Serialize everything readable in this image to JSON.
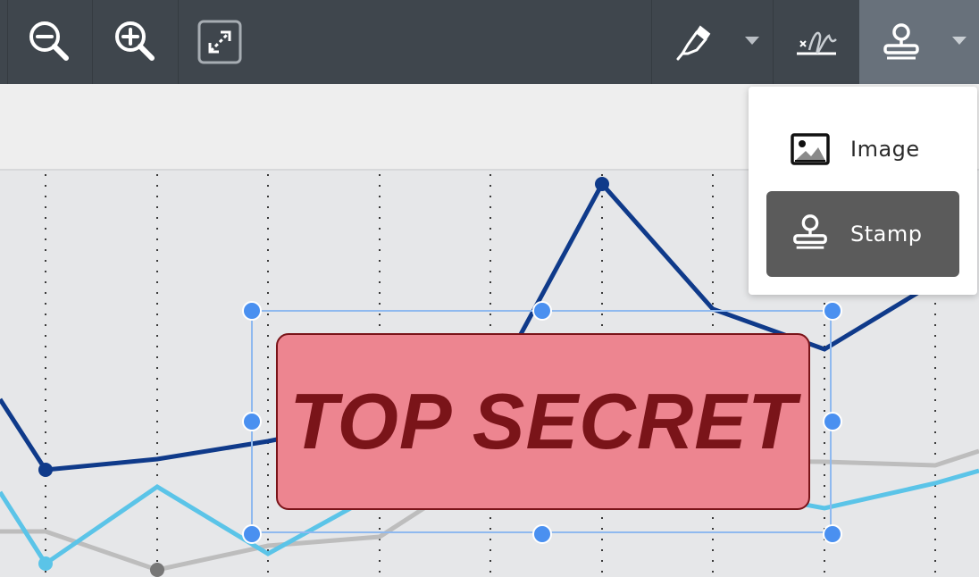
{
  "toolbar": {
    "buttons": [
      {
        "name": "zoom-out-button",
        "icon": "zoom-out-icon"
      },
      {
        "name": "zoom-in-button",
        "icon": "zoom-in-icon"
      },
      {
        "name": "fit-page-button",
        "icon": "expand-arrows-icon"
      },
      {
        "name": "annotate-pen-button",
        "icon": "highlighter-pen-icon"
      },
      {
        "name": "signature-button",
        "icon": "signature-icon"
      },
      {
        "name": "stamp-tool-button",
        "icon": "stamp-icon",
        "active": true
      }
    ]
  },
  "dropdown": {
    "items": [
      {
        "label": "Image",
        "icon": "image-icon",
        "selected": false
      },
      {
        "label": "Stamp",
        "icon": "stamp-icon",
        "selected": true
      }
    ]
  },
  "stamp": {
    "text": "TOP SECRET",
    "fill_color": "#ed8590",
    "text_color": "#7a1419"
  },
  "colors": {
    "toolbar_bg": "#3f464d",
    "toolbar_active_bg": "#68717b",
    "selection_handle": "#4a90f0",
    "series_dark_blue": "#0f3a8a",
    "series_light_blue": "#5bc4e8",
    "series_gray": "#bdbdbd"
  }
}
